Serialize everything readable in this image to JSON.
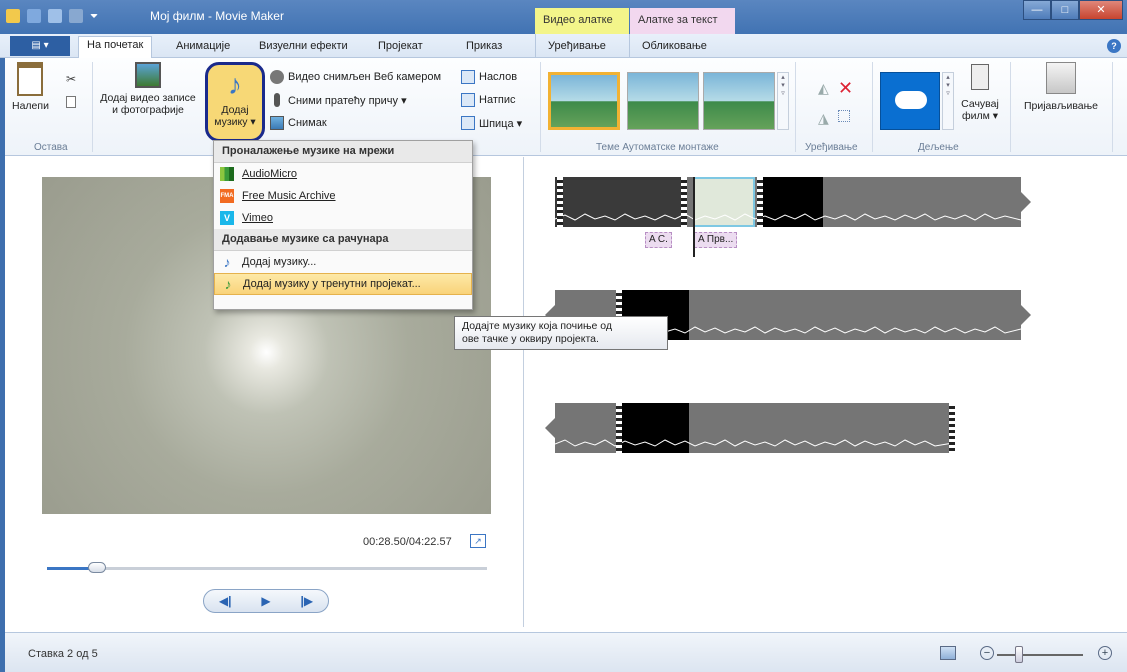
{
  "window": {
    "title": "Мој филм - Movie Maker",
    "context_tabs": {
      "video_tools": "Видео алатке",
      "text_tools": "Алатке за текст"
    },
    "controls": {
      "minimize": "—",
      "maximize": "□",
      "close": "✕"
    }
  },
  "ribbon_tabs": {
    "file": "▤ ▾",
    "tabs": [
      "На почетак",
      "Анимације",
      "Визуелни ефекти",
      "Пројекат",
      "Приказ",
      "Уређивање",
      "Обликовање"
    ],
    "help": "?"
  },
  "ribbon": {
    "clipboard": {
      "paste": "Налепи",
      "group": "Остава"
    },
    "add": {
      "add_videos_line1": "Додај видео записе",
      "add_videos_line2": "и фотографије",
      "add_music_line1": "Додај",
      "add_music_line2": "музику ▾",
      "webcam": "Видео снимљен Веб камером",
      "narration": "Сними пратећу причу ▾",
      "snapshot": "Снимак",
      "title": "Наслов",
      "caption": "Натпис",
      "credits": "Шпица ▾"
    },
    "themes_group": "Теме Аутоматске монтаже",
    "editing_group": "Уређивање",
    "sharing": {
      "save_movie_line1": "Сачувај",
      "save_movie_line2": "филм ▾",
      "group": "Дељење"
    },
    "sign_in": "Пријављивање"
  },
  "menu": {
    "online_header": "Проналажење музике на мрежи",
    "online_items": [
      {
        "label": "AudioMicro",
        "icon_text": ""
      },
      {
        "label": "Free Music Archive",
        "icon_text": "FMA"
      },
      {
        "label": "Vimeo",
        "icon_text": "V"
      }
    ],
    "pc_header": "Додавање музике са рачунара",
    "pc_items": [
      "Додај музику...",
      "Додај музику у тренутни пројекат..."
    ]
  },
  "tooltip": {
    "line1": "Додајте музику која почиње од",
    "line2": "ове тачке у оквиру пројекта."
  },
  "preview": {
    "timecode": "00:28.50/04:22.57",
    "progress_percent": 11,
    "prev": "◀|",
    "play": "▶",
    "next": "|▶"
  },
  "captions": {
    "c1": "A C.",
    "c2": "A Прв..."
  },
  "status": {
    "text": "Ставка 2 од 5",
    "zoom_minus": "−",
    "zoom_plus": "+"
  },
  "colors": {
    "accent": "#3b76c4",
    "highlight": "#f9d37a",
    "strip": "#757575"
  }
}
